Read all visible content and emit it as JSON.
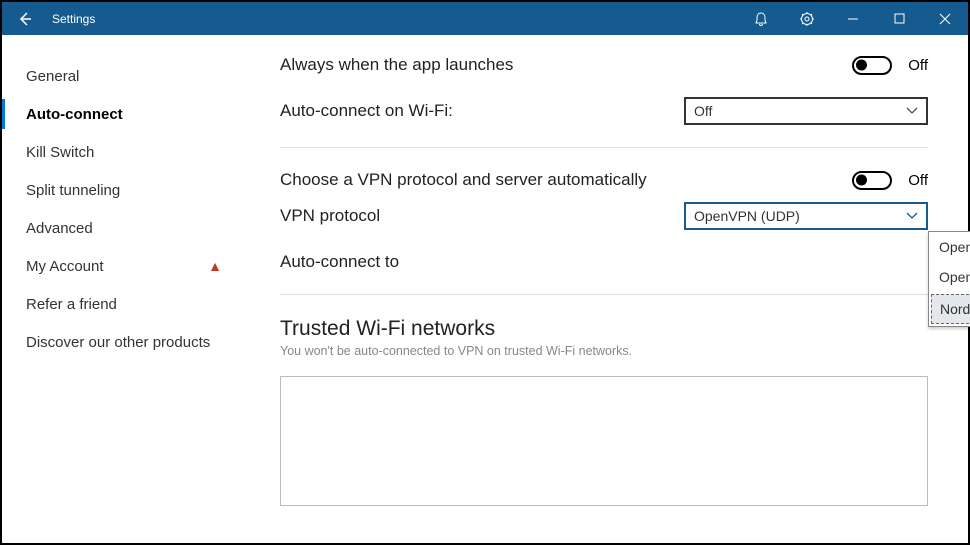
{
  "titlebar": {
    "title": "Settings"
  },
  "sidebar": {
    "items": [
      {
        "label": "General"
      },
      {
        "label": "Auto-connect"
      },
      {
        "label": "Kill Switch"
      },
      {
        "label": "Split tunneling"
      },
      {
        "label": "Advanced"
      },
      {
        "label": "My Account"
      },
      {
        "label": "Refer a friend"
      },
      {
        "label": "Discover our other products"
      }
    ]
  },
  "main": {
    "launch_label": "Always when the app launches",
    "launch_toggle_state": "Off",
    "wifi_label": "Auto-connect on Wi-Fi:",
    "wifi_select_value": "Off",
    "protocol_auto_label": "Choose a VPN protocol and server automatically",
    "protocol_auto_state": "Off",
    "vpn_protocol_label": "VPN protocol",
    "vpn_protocol_value": "OpenVPN (UDP)",
    "vpn_protocol_options": [
      "OpenVPN (UDP)",
      "OpenVPN (TCP)",
      "NordLynx  Recommended"
    ],
    "connect_to_label": "Auto-connect to",
    "trusted_heading": "Trusted Wi-Fi networks",
    "trusted_sub": "You won't be auto-connected to VPN on trusted Wi-Fi networks."
  }
}
